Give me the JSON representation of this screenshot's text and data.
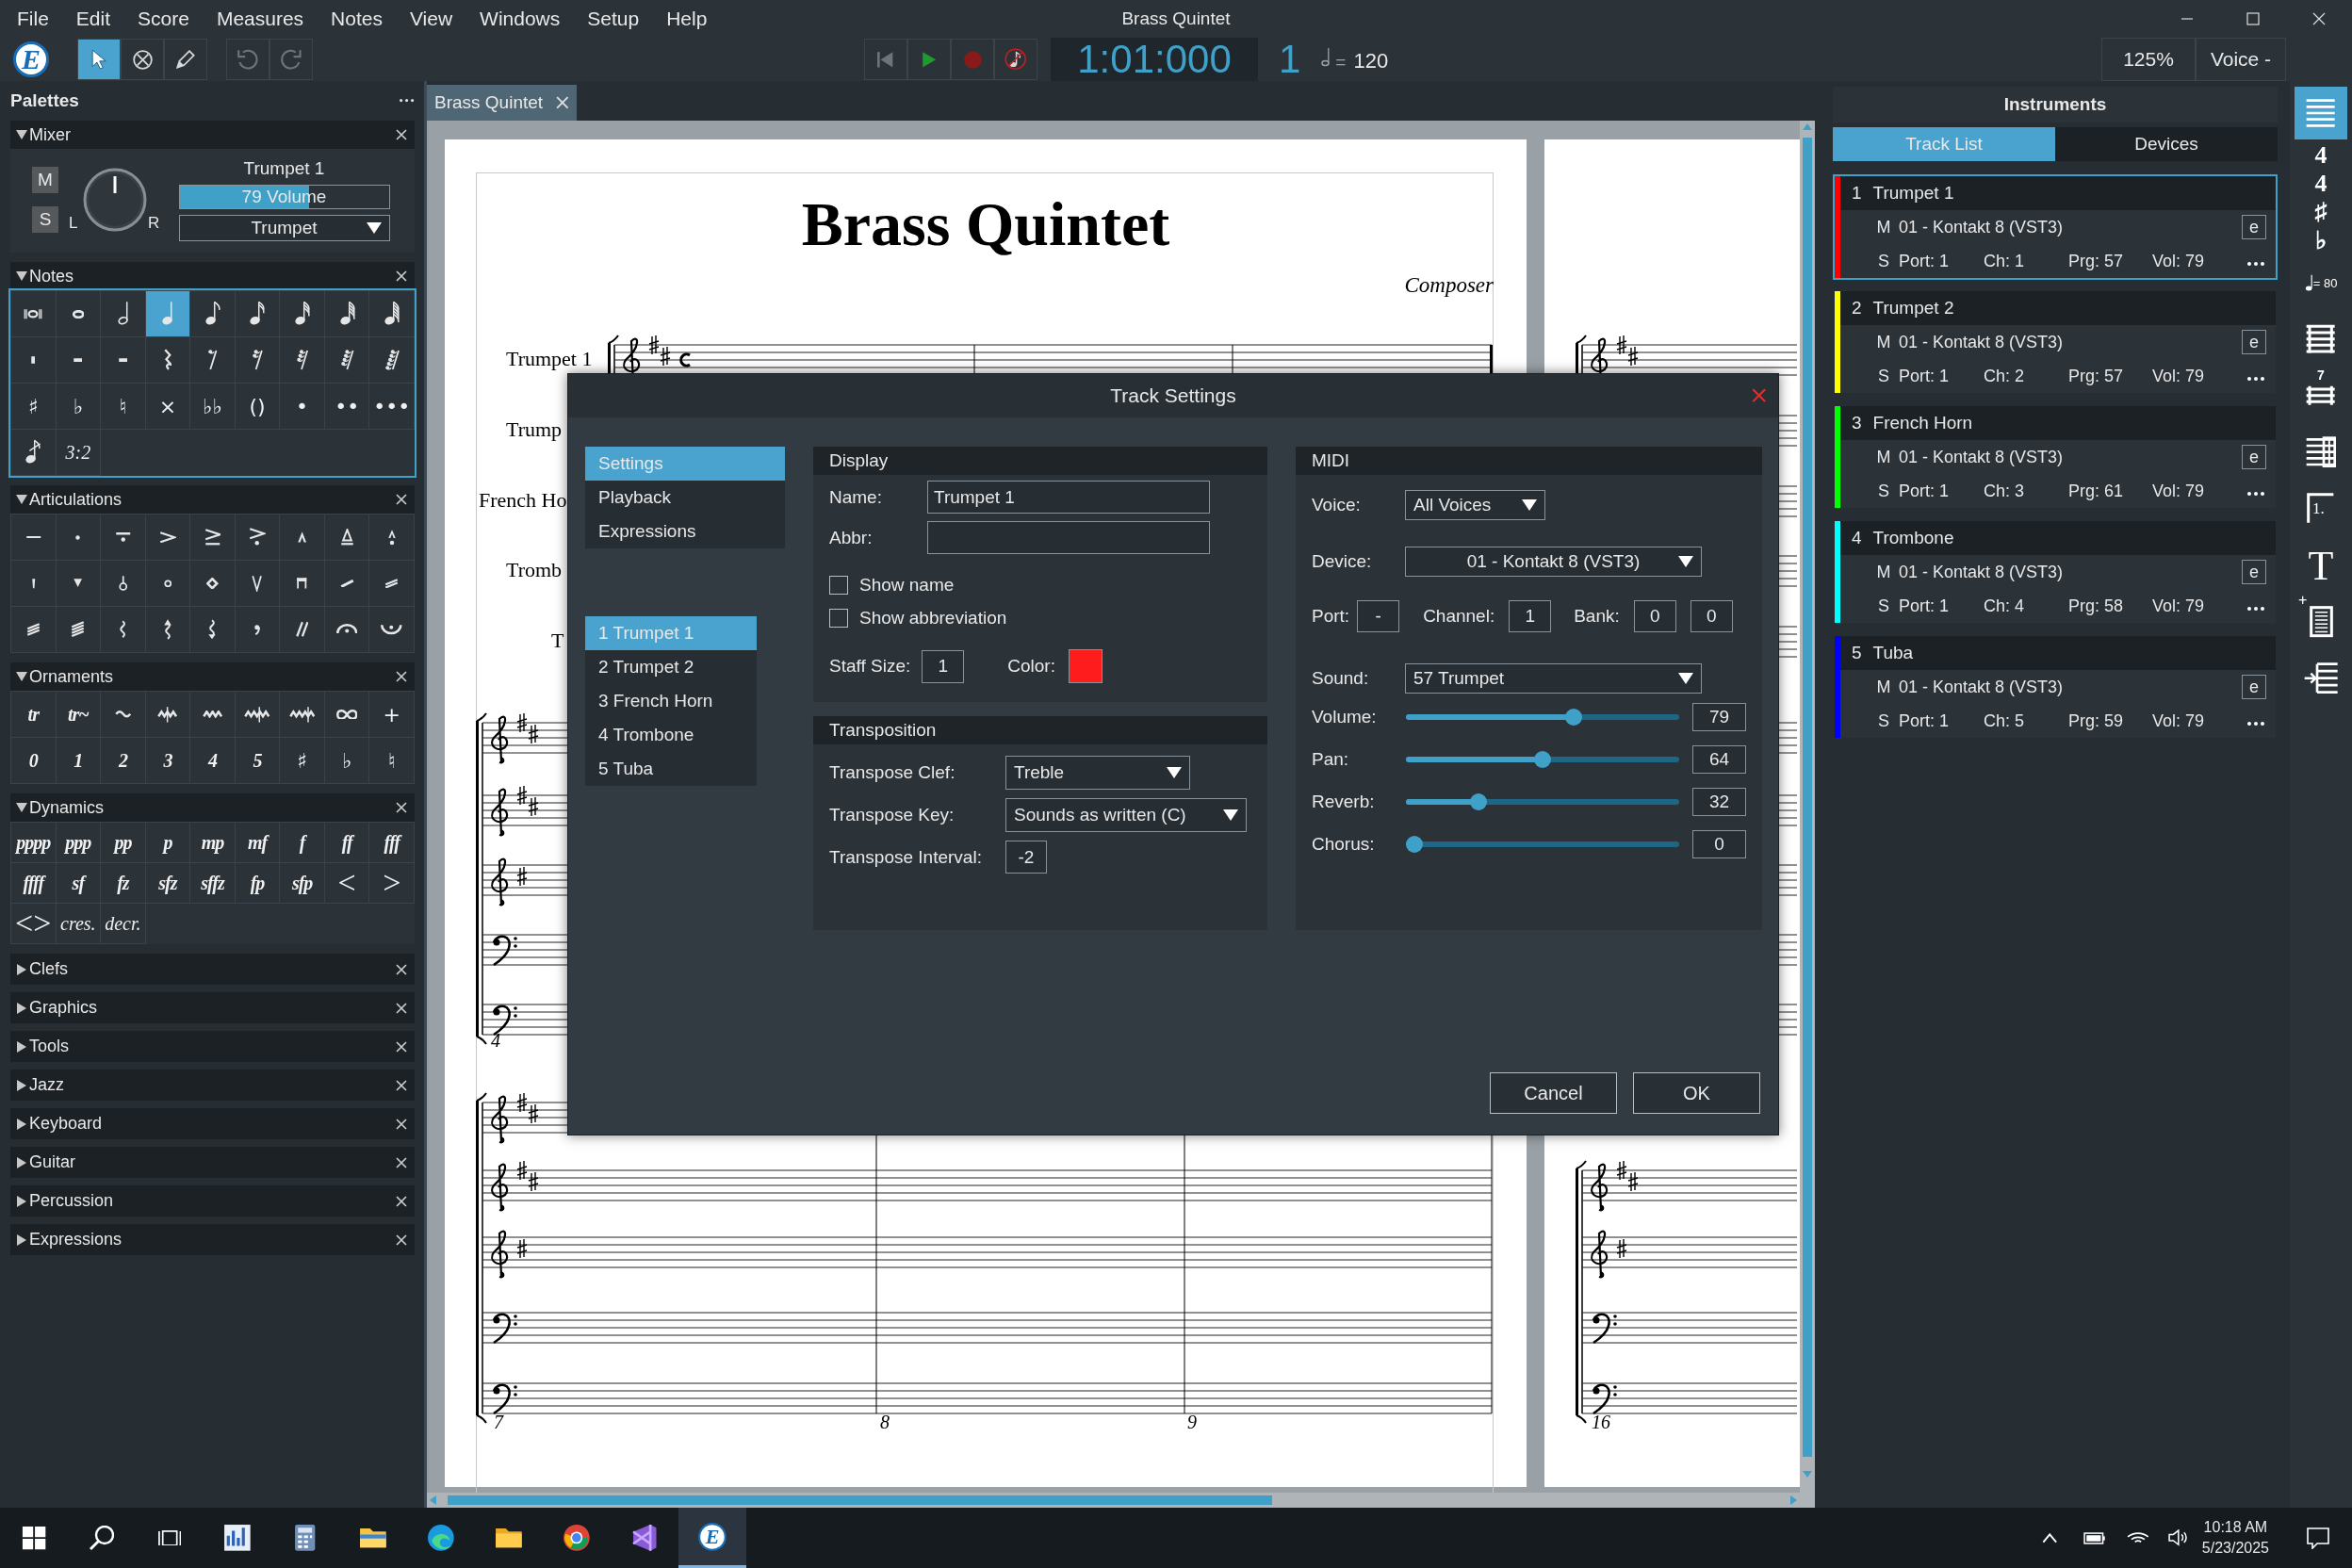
{
  "menu": [
    "File",
    "Edit",
    "Score",
    "Measures",
    "Notes",
    "View",
    "Windows",
    "Setup",
    "Help"
  ],
  "app_title": "Brass Quintet",
  "logo": "E",
  "tools": [
    {
      "selected": true
    },
    {
      "selected": false
    },
    {
      "selected": false
    }
  ],
  "history": [
    {
      "disabled": true
    },
    {
      "disabled": true
    }
  ],
  "counter": "1:01:000",
  "beat": "1",
  "tempo_sign": "=",
  "tempo": "120",
  "zoom": "125%",
  "voice": "Voice -",
  "palettes": {
    "title": "Palettes",
    "sections": [
      {
        "kind": "mixer",
        "title": "Mixer",
        "expanded": true,
        "mute": "M",
        "solo": "S",
        "pan_left": "L",
        "pan_right": "R",
        "track": "Trumpet 1",
        "volume": "79 Volume",
        "level": 0.62,
        "instrument": "Trumpet"
      },
      {
        "kind": "grid",
        "title": "Notes",
        "expanded": true,
        "cells": [
          {
            "kind": "icon",
            "selected": false
          },
          {
            "kind": "icon",
            "selected": false
          },
          {
            "kind": "icon",
            "selected": false
          },
          {
            "kind": "icon",
            "selected": true
          },
          {
            "kind": "icon",
            "selected": false
          },
          {
            "kind": "icon",
            "selected": false
          },
          {
            "kind": "icon",
            "selected": false
          },
          {
            "kind": "icon",
            "selected": false
          },
          {
            "kind": "icon",
            "selected": false
          },
          {
            "kind": "icon",
            "selected": false
          },
          {
            "kind": "icon",
            "selected": false
          },
          {
            "kind": "icon",
            "selected": false
          },
          {
            "kind": "icon",
            "selected": false
          },
          {
            "kind": "icon",
            "selected": false
          },
          {
            "kind": "icon",
            "selected": false
          },
          {
            "kind": "icon",
            "selected": false
          },
          {
            "kind": "icon",
            "selected": false
          },
          {
            "kind": "icon",
            "selected": false
          },
          {
            "kind": "symbol",
            "text": "♯",
            "selected": false
          },
          {
            "kind": "symbol",
            "text": "♭",
            "selected": false
          },
          {
            "kind": "symbol",
            "text": "♮",
            "selected": false
          },
          {
            "kind": "symbol",
            "text": "×",
            "selected": false
          },
          {
            "kind": "symbol",
            "text": "♭♭",
            "selected": false
          },
          {
            "kind": "symbol",
            "text": "()",
            "selected": false
          },
          {
            "kind": "symbol",
            "text": "•",
            "selected": false
          },
          {
            "kind": "symbol",
            "text": "••",
            "selected": false
          },
          {
            "kind": "symbol",
            "text": "•••",
            "selected": false
          },
          {
            "kind": "icon",
            "selected": false
          },
          {
            "kind": "word",
            "text": "3:2",
            "selected": false
          }
        ]
      },
      {
        "kind": "grid",
        "title": "Articulations",
        "expanded": true,
        "cells": [
          {
            "kind": "icon",
            "selected": false
          },
          {
            "kind": "icon",
            "selected": false
          },
          {
            "kind": "icon",
            "selected": false
          },
          {
            "kind": "icon",
            "selected": false
          },
          {
            "kind": "icon",
            "selected": false
          },
          {
            "kind": "icon",
            "selected": false
          },
          {
            "kind": "icon",
            "selected": false
          },
          {
            "kind": "icon",
            "selected": false
          },
          {
            "kind": "icon",
            "selected": false
          },
          {
            "kind": "icon",
            "selected": false
          },
          {
            "kind": "icon",
            "selected": false
          },
          {
            "kind": "icon",
            "selected": false
          },
          {
            "kind": "icon",
            "selected": false
          },
          {
            "kind": "icon",
            "selected": false
          },
          {
            "kind": "icon",
            "selected": false
          },
          {
            "kind": "icon",
            "selected": false
          },
          {
            "kind": "icon",
            "selected": false
          },
          {
            "kind": "icon",
            "selected": false
          },
          {
            "kind": "icon",
            "selected": false
          },
          {
            "kind": "icon",
            "selected": false
          },
          {
            "kind": "icon",
            "selected": false
          },
          {
            "kind": "icon",
            "selected": false
          },
          {
            "kind": "icon",
            "selected": false
          },
          {
            "kind": "icon",
            "selected": false
          },
          {
            "kind": "icon",
            "selected": false
          },
          {
            "kind": "icon",
            "selected": false
          },
          {
            "kind": "icon",
            "selected": false
          }
        ]
      },
      {
        "kind": "grid",
        "title": "Ornaments",
        "expanded": true,
        "cells": [
          {
            "kind": "dynamic",
            "text": "tr",
            "selected": false
          },
          {
            "kind": "dynamic",
            "text": "tr~",
            "selected": false
          },
          {
            "kind": "icon",
            "selected": false
          },
          {
            "kind": "icon",
            "selected": false
          },
          {
            "kind": "icon",
            "selected": false
          },
          {
            "kind": "icon",
            "selected": false
          },
          {
            "kind": "icon",
            "selected": false
          },
          {
            "kind": "icon",
            "selected": false
          },
          {
            "kind": "symbol",
            "text": "+",
            "selected": false
          },
          {
            "kind": "dynamic",
            "text": "0",
            "selected": false
          },
          {
            "kind": "dynamic",
            "text": "1",
            "selected": false
          },
          {
            "kind": "dynamic",
            "text": "2",
            "selected": false
          },
          {
            "kind": "dynamic",
            "text": "3",
            "selected": false
          },
          {
            "kind": "dynamic",
            "text": "4",
            "selected": false
          },
          {
            "kind": "dynamic",
            "text": "5",
            "selected": false
          },
          {
            "kind": "symbol",
            "text": "♯",
            "selected": false
          },
          {
            "kind": "symbol",
            "text": "♭",
            "selected": false
          },
          {
            "kind": "symbol",
            "text": "♮",
            "selected": false
          }
        ]
      },
      {
        "kind": "grid",
        "title": "Dynamics",
        "expanded": true,
        "cells": [
          {
            "kind": "dynamic",
            "text": "pppp",
            "selected": false
          },
          {
            "kind": "dynamic",
            "text": "ppp",
            "selected": false
          },
          {
            "kind": "dynamic",
            "text": "pp",
            "selected": false
          },
          {
            "kind": "dynamic",
            "text": "p",
            "selected": false
          },
          {
            "kind": "dynamic",
            "text": "mp",
            "selected": false
          },
          {
            "kind": "dynamic",
            "text": "mf",
            "selected": false
          },
          {
            "kind": "dynamic",
            "text": "f",
            "selected": false
          },
          {
            "kind": "dynamic",
            "text": "ff",
            "selected": false
          },
          {
            "kind": "dynamic",
            "text": "fff",
            "selected": false
          },
          {
            "kind": "dynamic",
            "text": "ffff",
            "selected": false
          },
          {
            "kind": "dynamic",
            "text": "sf",
            "selected": false
          },
          {
            "kind": "dynamic",
            "text": "fz",
            "selected": false
          },
          {
            "kind": "dynamic",
            "text": "sfz",
            "selected": false
          },
          {
            "kind": "dynamic",
            "text": "sffz",
            "selected": false
          },
          {
            "kind": "dynamic",
            "text": "fp",
            "selected": false
          },
          {
            "kind": "dynamic",
            "text": "sfp",
            "selected": false
          },
          {
            "kind": "hairpin",
            "text": "<",
            "selected": false
          },
          {
            "kind": "hairpin",
            "text": ">",
            "selected": false
          },
          {
            "kind": "hairpin",
            "text": "<>",
            "selected": false
          },
          {
            "kind": "word",
            "text": "cres.",
            "selected": false
          },
          {
            "kind": "word",
            "text": "decr.",
            "selected": false
          }
        ]
      },
      {
        "kind": "grid",
        "title": "Clefs",
        "expanded": false
      },
      {
        "kind": "grid",
        "title": "Graphics",
        "expanded": false
      },
      {
        "kind": "grid",
        "title": "Tools",
        "expanded": false
      },
      {
        "kind": "grid",
        "title": "Jazz",
        "expanded": false
      },
      {
        "kind": "grid",
        "title": "Keyboard",
        "expanded": false
      },
      {
        "kind": "grid",
        "title": "Guitar",
        "expanded": false
      },
      {
        "kind": "grid",
        "title": "Percussion",
        "expanded": false
      },
      {
        "kind": "grid",
        "title": "Expressions",
        "expanded": false
      }
    ]
  },
  "document_tab": {
    "label": "Brass Quintet",
    "selected": true
  },
  "score": {
    "title": "Brass Quintet",
    "composer": "Composer",
    "staff_labels": [
      "Trumpet 1",
      "Trump",
      "French Ho",
      "Tromb",
      "T"
    ],
    "measure_numbers": [
      "4",
      "7",
      "8",
      "9"
    ],
    "next_page_measure_numbers": [
      "16"
    ]
  },
  "dialog": {
    "title": "Track Settings",
    "pages": [
      {
        "label": "Settings",
        "selected": true
      },
      {
        "label": "Playback",
        "selected": false
      },
      {
        "label": "Expressions",
        "selected": false
      }
    ],
    "tracks": [
      {
        "label": "1 Trumpet 1",
        "selected": true
      },
      {
        "label": "2 Trumpet 2",
        "selected": false
      },
      {
        "label": "3 French Horn",
        "selected": false
      },
      {
        "label": "4 Trombone",
        "selected": false
      },
      {
        "label": "5 Tuba",
        "selected": false
      }
    ],
    "display": {
      "title": "Display",
      "name_label": "Name:",
      "name": "Trumpet 1",
      "abbr_label": "Abbr:",
      "checkboxes": [
        {
          "label": "Show name",
          "checked": false
        },
        {
          "label": "Show abbreviation",
          "checked": false
        }
      ],
      "staff_size_label": "Staff Size:",
      "staff_size": "1",
      "color_label": "Color:",
      "color": "#ff1c1c"
    },
    "transposition": {
      "title": "Transposition",
      "clef_label": "Transpose Clef:",
      "clef": "Treble",
      "key_label": "Transpose Key:",
      "key": "Sounds as written (C)",
      "interval_label": "Transpose Interval:",
      "interval": "-2"
    },
    "midi": {
      "title": "MIDI",
      "voice_label": "Voice:",
      "voice": "All Voices",
      "device_label": "Device:",
      "device": "01 - Kontakt 8 (VST3)",
      "port_label": "Port:",
      "port": "-",
      "channel_label": "Channel:",
      "channel": "1",
      "bank_label": "Bank:",
      "bank": [
        "0",
        "0"
      ],
      "sound_label": "Sound:",
      "sound": "57 Trumpet",
      "sliders": [
        {
          "label": "Volume:",
          "level": 0.62,
          "value": "79"
        },
        {
          "label": "Pan:",
          "level": 0.5,
          "value": "64"
        },
        {
          "label": "Reverb:",
          "level": 0.25,
          "value": "32"
        },
        {
          "label": "Chorus:",
          "level": 0,
          "value": "0"
        }
      ]
    },
    "buttons": [
      "Cancel",
      "OK"
    ]
  },
  "instruments": {
    "title": "Instruments",
    "tabs": [
      {
        "label": "Track List",
        "selected": true
      },
      {
        "label": "Devices",
        "selected": false
      }
    ],
    "tracks": [
      {
        "number": "1",
        "name": "Trumpet 1",
        "color": "#ff0000",
        "selected": true,
        "mute": "M",
        "solo": "S",
        "device": "01 - Kontakt 8 (VST3)",
        "edit": "e",
        "port": "Port: 1",
        "channel": "Ch: 1",
        "program": "Prg: 57",
        "volume": "Vol: 79"
      },
      {
        "number": "2",
        "name": "Trumpet 2",
        "color": "#ffff00",
        "selected": false,
        "mute": "M",
        "solo": "S",
        "device": "01 - Kontakt 8 (VST3)",
        "edit": "e",
        "port": "Port: 1",
        "channel": "Ch: 2",
        "program": "Prg: 57",
        "volume": "Vol: 79"
      },
      {
        "number": "3",
        "name": "French Horn",
        "color": "#00ff00",
        "selected": false,
        "mute": "M",
        "solo": "S",
        "device": "01 - Kontakt 8 (VST3)",
        "edit": "e",
        "port": "Port: 1",
        "channel": "Ch: 3",
        "program": "Prg: 61",
        "volume": "Vol: 79"
      },
      {
        "number": "4",
        "name": "Trombone",
        "color": "#00ffff",
        "selected": false,
        "mute": "M",
        "solo": "S",
        "device": "01 - Kontakt 8 (VST3)",
        "edit": "e",
        "port": "Port: 1",
        "channel": "Ch: 4",
        "program": "Prg: 58",
        "volume": "Vol: 79"
      },
      {
        "number": "5",
        "name": "Tuba",
        "color": "#0000ff",
        "selected": false,
        "mute": "M",
        "solo": "S",
        "device": "01 - Kontakt 8 (VST3)",
        "edit": "e",
        "port": "Port: 1",
        "channel": "Ch: 5",
        "program": "Prg: 59",
        "volume": "Vol: 79"
      }
    ]
  },
  "side_tools": [
    {
      "selected": true
    },
    {
      "selected": false,
      "texts": [
        "4",
        "4"
      ]
    },
    {
      "selected": false,
      "texts": [
        "♯",
        "♭"
      ]
    },
    {
      "selected": false,
      "texts": [
        "= 80"
      ]
    },
    {
      "selected": false
    },
    {
      "selected": false,
      "texts": [
        "7"
      ]
    },
    {
      "selected": false
    },
    {
      "selected": false,
      "texts": [
        "1."
      ]
    },
    {
      "selected": false,
      "texts": [
        "T"
      ]
    },
    {
      "selected": false,
      "texts": [
        "+"
      ]
    },
    {
      "selected": false
    }
  ],
  "taskbar": {
    "apps": [
      {
        "selected": false
      },
      {
        "selected": false
      },
      {
        "selected": false
      },
      {
        "selected": false
      },
      {
        "selected": false
      },
      {
        "selected": false
      },
      {
        "selected": false
      },
      {
        "selected": true,
        "text": "E"
      }
    ],
    "time": "10:18 AM",
    "date": "5/23/2025"
  }
}
